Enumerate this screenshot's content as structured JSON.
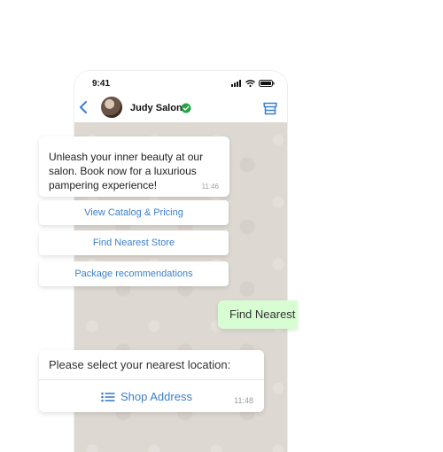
{
  "status_bar": {
    "time": "9:41"
  },
  "header": {
    "contact_name": "Judy Salon"
  },
  "messages": {
    "welcome": {
      "text": "Unleash your inner beauty at our salon. Book now for a luxurious pampering experience!",
      "time": "11:46"
    },
    "quick_replies": [
      "View Catalog & Pricing",
      "Find Nearest Store",
      "Package recommendations"
    ],
    "outgoing": {
      "text": "Find Nearest Store"
    },
    "location_prompt": {
      "text": "Please select your nearest location:",
      "button_label": "Shop Address",
      "time": "11:48"
    }
  },
  "colors": {
    "accent": "#3b7fd0",
    "verified": "#25a244",
    "outgoing_bubble": "#d9fdd3",
    "chat_background": "#ded8d2"
  },
  "icons": [
    "back-icon",
    "avatar",
    "verified-icon",
    "store-icon",
    "list-icon",
    "signal-icon",
    "wifi-icon",
    "battery-icon"
  ]
}
